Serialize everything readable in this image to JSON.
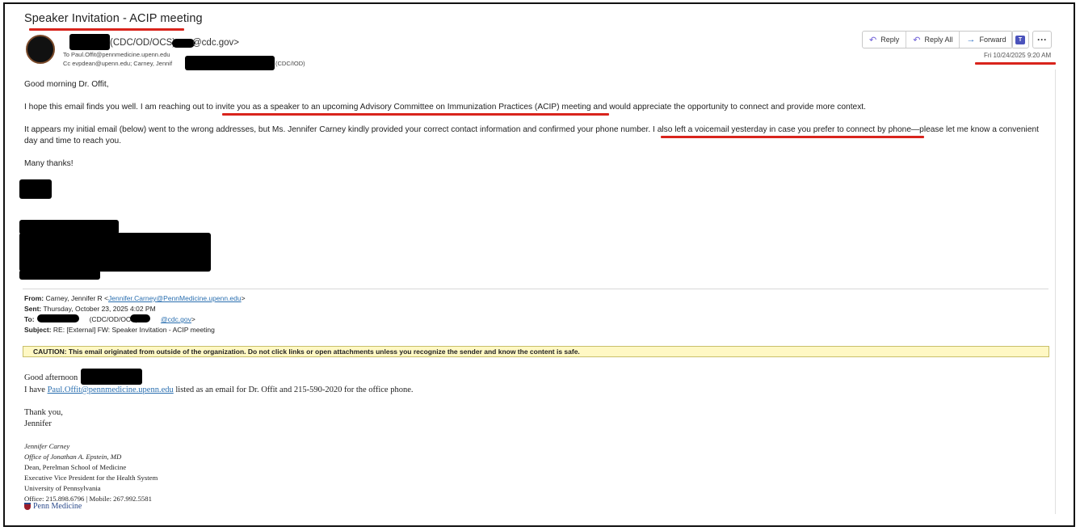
{
  "email": {
    "subject": "Speaker Invitation - ACIP meeting",
    "sender_display": "(CDC/OD/OCS) <",
    "sender_email_suffix": "@cdc.gov>",
    "to_line": "To   Paul.Offit@pennmedicine.upenn.edu",
    "cc_line": "Cc   evpdean@upenn.edu; Carney, Jennif",
    "cc_suffix": "(CDC/IOD)",
    "date": "Fri 10/24/2025 9:20 AM"
  },
  "toolbar": {
    "reply_label": "Reply",
    "reply_all_label": "Reply All",
    "forward_label": "Forward",
    "more_label": "···"
  },
  "body": {
    "greeting": "Good morning Dr. Offit,",
    "p1_a": "I hope this email finds you well. I am reaching out to ",
    "p1_b": "invite you as a speaker to an upcoming Advisory Committee on Immunization Practices (ACIP) meeting",
    "p1_c": " and would appreciate the opportunity to connect and provide more context.",
    "p2_a": "It appears my initial email (below) went to the wrong addresses, but Ms. Jennifer Carney kindly provided your correct contact information and confirmed your phone number. ",
    "p2_b": "I also left a voicemail yesterday in case you prefer to connect by phone",
    "p2_c": "—please let me know a convenient",
    "p2_line2": "day and time to reach you.",
    "closing": "Many thanks!"
  },
  "forwarded": {
    "from_label": "From:",
    "from_value": " Carney, Jennifer R <",
    "from_link": "Jennifer.Carney@PennMedicine.upenn.edu",
    "from_end": ">",
    "sent_label": "Sent:",
    "sent_value": " Thursday, October 23, 2025 4:02 PM",
    "to_label": "To:",
    "to_value": "(CDC/OD/OCS) ",
    "to_link": "@cdc.gov",
    "to_end": ">",
    "subject_label": "Subject:",
    "subject_value": " RE: [External] FW: Speaker Invitation - ACIP meeting",
    "caution": "CAUTION: This email originated from outside of the organization. Do not click links or open attachments unless you recognize the sender and know the content is safe.",
    "greeting": "Good afternoon",
    "line_a": "I have ",
    "line_link": "Paul.Offit@pennmedicine.upenn.edu",
    "line_b": " listed as an email for Dr. Offit and 215-590-2020 for the office phone.",
    "thanks": "Thank you,",
    "name": "Jennifer"
  },
  "signature": {
    "name": "Jennifer Carney",
    "office": "Office of Jonathan A. Epstein, MD",
    "l1": "Dean, Perelman School of Medicine",
    "l2": "Executive Vice President for the Health System",
    "l3": "University of Pennsylvania",
    "l4": "Office: 215.898.6796 | Mobile: 267.992.5581",
    "logo_text": "Penn Medicine"
  }
}
